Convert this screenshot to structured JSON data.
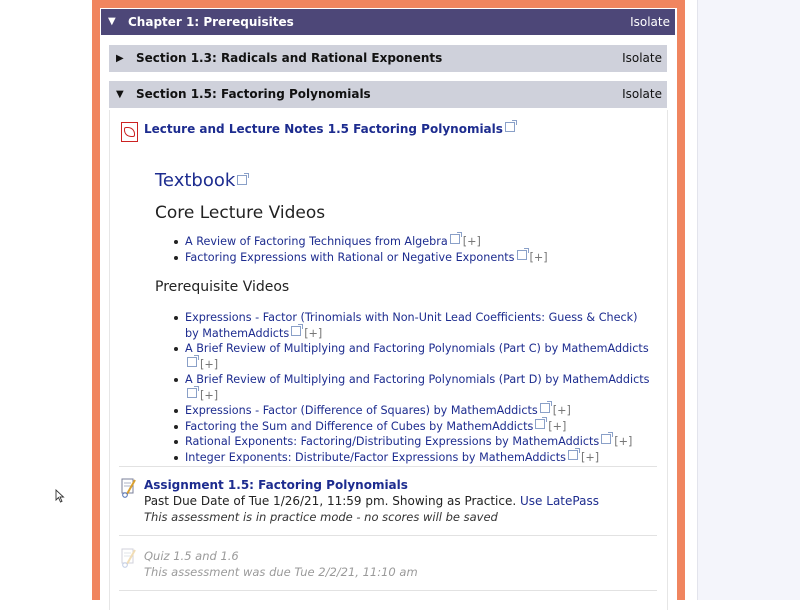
{
  "chapter": {
    "title": "Chapter 1: Prerequisites",
    "isolate": "Isolate"
  },
  "sections": [
    {
      "title": "Section 1.3: Radicals and Rational Exponents",
      "isolate": "Isolate"
    },
    {
      "title": "Section 1.5: Factoring Polynomials",
      "isolate": "Isolate"
    }
  ],
  "lecture_link": "Lecture and Lecture Notes 1.5 Factoring Polynomials",
  "textbook": "Textbook",
  "core_heading": "Core Lecture Videos",
  "core_videos": [
    "A Review of Factoring Techniques from Algebra",
    "Factoring Expressions with Rational or Negative Exponents"
  ],
  "prereq_heading": "Prerequisite Videos",
  "prereq_videos": [
    "Expressions - Factor (Trinomials with Non-Unit Lead Coefficients: Guess & Check) by MathemAddicts",
    "A Brief Review of Multiplying and Factoring Polynomials (Part C) by MathemAddicts",
    "A Brief Review of Multiplying and Factoring Polynomials (Part D) by MathemAddicts",
    "Expressions - Factor (Difference of Squares) by MathemAddicts",
    "Factoring the Sum and Difference of Cubes by MathemAddicts",
    "Rational Exponents: Factoring/Distributing Expressions by MathemAddicts",
    "Integer Exponents: Distribute/Factor Expressions by MathemAddicts"
  ],
  "expand_label": "[+]",
  "assignment": {
    "title": "Assignment 1.5: Factoring Polynomials",
    "due_text": "Past Due Date of Tue 1/26/21, 11:59 pm. Showing as Practice.",
    "use_label": "Use",
    "latepass_label": "LatePass",
    "note": "This assessment is in practice mode - no scores will be saved"
  },
  "quiz": {
    "title": "Quiz 1.5 and 1.6",
    "note": "This assessment was due Tue 2/2/21, 11:10 am"
  },
  "colors": {
    "chapter_bar": "#4d4778",
    "section_bar": "#cfd1db",
    "frame": "#f0855f",
    "link": "#1d2c8f"
  }
}
